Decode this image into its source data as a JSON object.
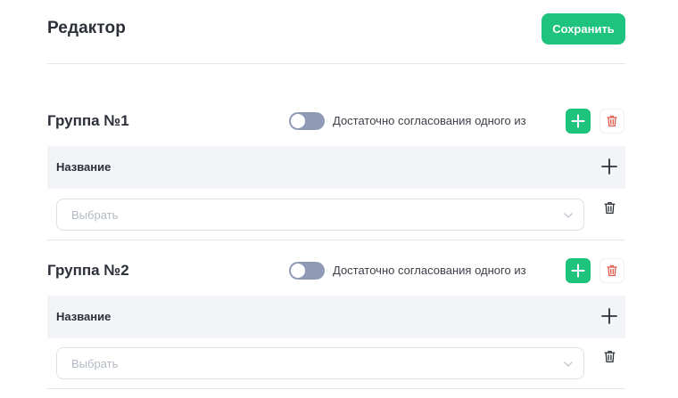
{
  "header": {
    "title": "Редактор",
    "save_label": "Сохранить"
  },
  "groups": [
    {
      "title": "Группа №1",
      "toggle_label": "Достаточно согласования одного из",
      "toggle_on": false,
      "column_title": "Название",
      "rows": [
        {
          "placeholder": "Выбрать"
        }
      ]
    },
    {
      "title": "Группа №2",
      "toggle_label": "Достаточно согласования одного из",
      "toggle_on": false,
      "column_title": "Название",
      "rows": [
        {
          "placeholder": "Выбрать"
        }
      ]
    }
  ],
  "icons": {
    "add": "plus-icon",
    "delete": "trash-icon",
    "select": "chevron-down-icon"
  },
  "colors": {
    "accent": "#1ec47d",
    "danger": "#e05a4f",
    "toggle_off": "#8f9bb5",
    "table_header_bg": "#f2f4f8"
  }
}
